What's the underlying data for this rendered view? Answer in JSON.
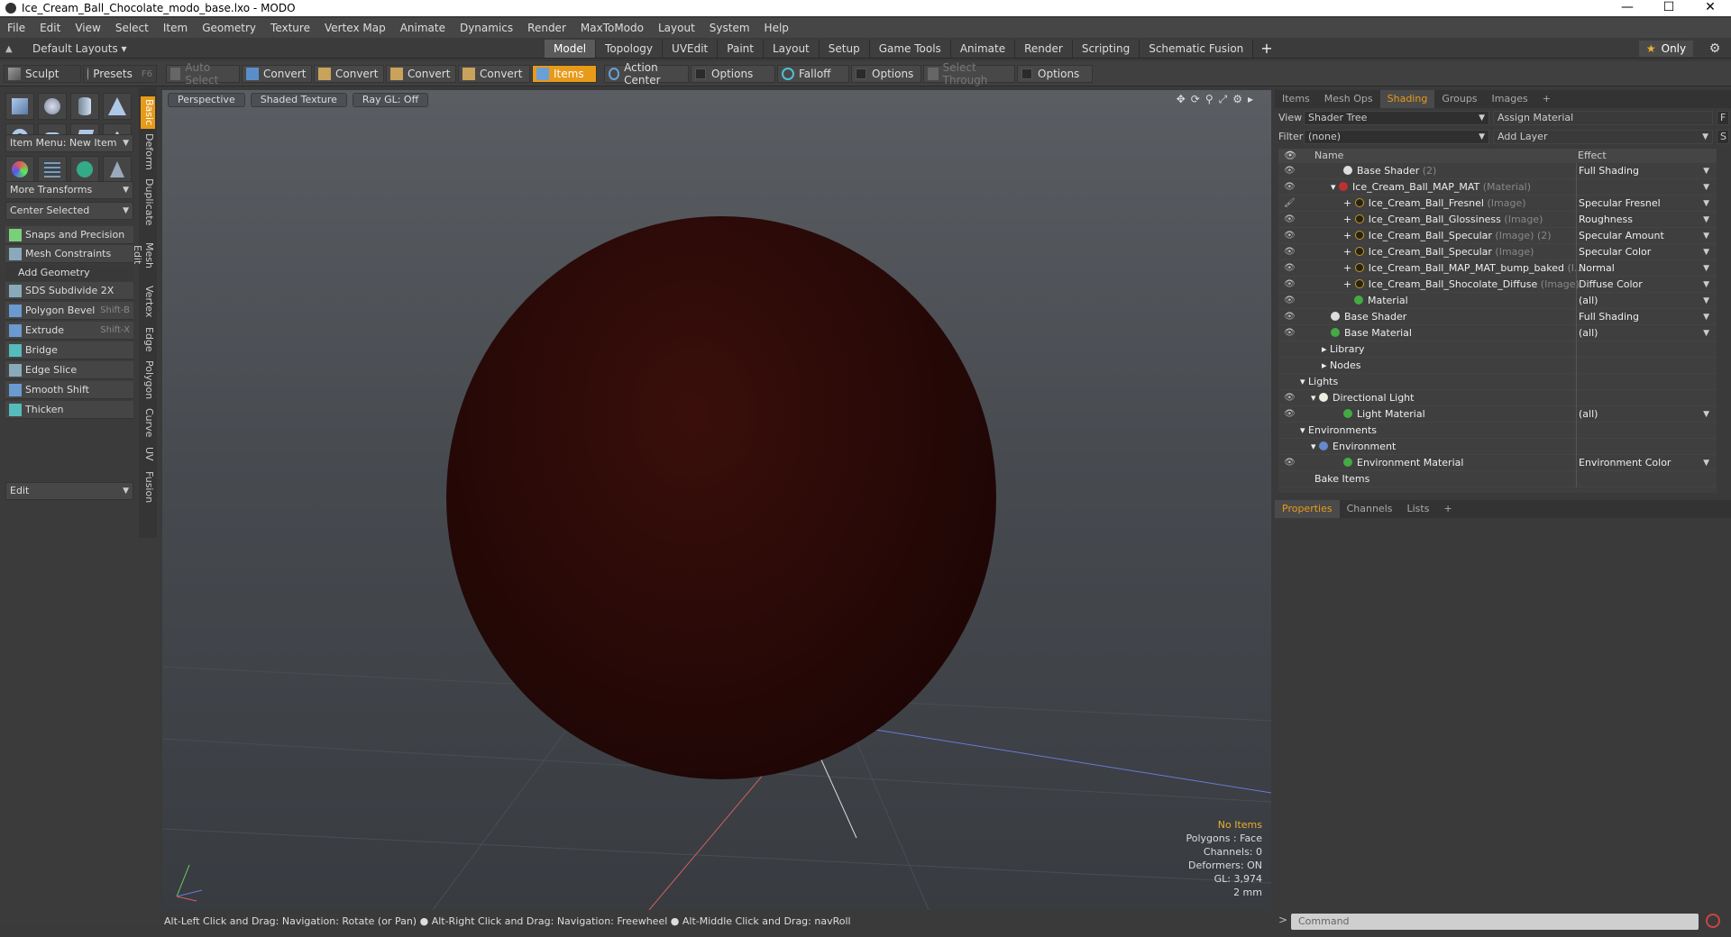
{
  "window": {
    "title": "Ice_Cream_Ball_Chocolate_modo_base.lxo - MODO",
    "minimize": "—",
    "maximize": "☐",
    "close": "✕"
  },
  "menu": [
    "File",
    "Edit",
    "View",
    "Select",
    "Item",
    "Geometry",
    "Texture",
    "Vertex Map",
    "Animate",
    "Dynamics",
    "Render",
    "MaxToModo",
    "Layout",
    "System",
    "Help"
  ],
  "layout": {
    "default_layouts": "Default Layouts ▾",
    "tabs": [
      "Model",
      "Topology",
      "UVEdit",
      "Paint",
      "Layout",
      "Setup",
      "Game Tools",
      "Animate",
      "Render",
      "Scripting",
      "Schematic Fusion"
    ],
    "active_tab": "Model",
    "plus": "+",
    "only": "Only"
  },
  "toolbar": {
    "sculpt": "Sculpt",
    "presets": "Presets",
    "presets_key": "F6",
    "auto_select": "Auto Select",
    "convert1": "Convert",
    "convert2": "Convert",
    "convert3": "Convert",
    "convert4": "Convert",
    "items": "Items",
    "action_center": "Action Center",
    "options1": "Options",
    "falloff": "Falloff",
    "options2": "Options",
    "select_through": "Select Through",
    "options3": "Options"
  },
  "left": {
    "vtabs": [
      "Basic",
      "Deform",
      "Duplicate",
      "Mesh Edit",
      "Vertex",
      "Edge",
      "Polygon",
      "Curve",
      "UV",
      "Fusion"
    ],
    "item_menu": "Item Menu: New Item",
    "more_transforms": "More Transforms",
    "center_selected": "Center Selected",
    "snaps": "Snaps and Precision",
    "mesh_constraints": "Mesh Constraints",
    "add_geometry": "Add Geometry",
    "tools": [
      {
        "label": "SDS Subdivide 2X",
        "shortcut": ""
      },
      {
        "label": "Polygon Bevel",
        "shortcut": "Shift-B"
      },
      {
        "label": "Extrude",
        "shortcut": "Shift-X"
      },
      {
        "label": "Bridge",
        "shortcut": ""
      },
      {
        "label": "Edge Slice",
        "shortcut": ""
      },
      {
        "label": "Smooth Shift",
        "shortcut": ""
      },
      {
        "label": "Thicken",
        "shortcut": ""
      }
    ],
    "edit": "Edit"
  },
  "viewport": {
    "perspective": "Perspective",
    "shaded_texture": "Shaded Texture",
    "raygl": "Ray GL: Off",
    "info": {
      "no_items": "No Items",
      "polygons": "Polygons : Face",
      "channels": "Channels: 0",
      "deformers": "Deformers: ON",
      "gl": "GL: 3,974",
      "scale": "2 mm"
    }
  },
  "status": "Alt-Left Click and Drag: Navigation: Rotate (or Pan) ● Alt-Right Click and Drag: Navigation: Freewheel ● Alt-Middle Click and Drag: navRoll",
  "right": {
    "tabs": [
      "Items",
      "Mesh Ops",
      "Shading",
      "Groups",
      "Images"
    ],
    "active_tab": "Shading",
    "view_label": "View",
    "view_value": "Shader Tree",
    "assign_material": "Assign Material",
    "f_btn": "F",
    "filter_label": "Filter",
    "filter_value": "(none)",
    "add_layer": "Add Layer",
    "s_btn": "S",
    "col_name": "Name",
    "col_effect": "Effect",
    "rows": [
      {
        "name": "Base Shader",
        "sub": " (2)",
        "effect": "Full Shading"
      },
      {
        "name": "Ice_Cream_Ball_MAP_MAT",
        "sub": " (Material)",
        "effect": ""
      },
      {
        "name": "Ice_Cream_Ball_Fresnel",
        "sub": " (Image)",
        "effect": "Specular Fresnel"
      },
      {
        "name": "Ice_Cream_Ball_Glossiness",
        "sub": " (Image)",
        "effect": "Roughness"
      },
      {
        "name": "Ice_Cream_Ball_Specular",
        "sub": " (Image) (2)",
        "effect": "Specular Amount"
      },
      {
        "name": "Ice_Cream_Ball_Specular",
        "sub": " (Image)",
        "effect": "Specular Color"
      },
      {
        "name": "Ice_Cream_Ball_MAP_MAT_bump_baked",
        "sub": " (I...",
        "effect": "Normal"
      },
      {
        "name": "Ice_Cream_Ball_Shocolate_Diffuse",
        "sub": " (Image)",
        "effect": "Diffuse Color"
      },
      {
        "name": "Material",
        "sub": "",
        "effect": "(all)"
      },
      {
        "name": "Base Shader",
        "sub": "",
        "effect": "Full Shading"
      },
      {
        "name": "Base Material",
        "sub": "",
        "effect": "(all)"
      },
      {
        "name": "Library",
        "sub": "",
        "effect": ""
      },
      {
        "name": "Nodes",
        "sub": "",
        "effect": ""
      },
      {
        "name": "Lights",
        "sub": "",
        "effect": ""
      },
      {
        "name": "Directional Light",
        "sub": "",
        "effect": ""
      },
      {
        "name": "Light Material",
        "sub": "",
        "effect": "(all)"
      },
      {
        "name": "Environments",
        "sub": "",
        "effect": ""
      },
      {
        "name": "Environment",
        "sub": "",
        "effect": ""
      },
      {
        "name": "Environment Material",
        "sub": "",
        "effect": "Environment Color"
      },
      {
        "name": "Bake Items",
        "sub": "",
        "effect": ""
      }
    ],
    "ptabs": [
      "Properties",
      "Channels",
      "Lists"
    ],
    "ptab_active": "Properties",
    "command_placeholder": "Command"
  },
  "colors": {
    "accent": "#e89a1a",
    "ball": "#240806"
  }
}
